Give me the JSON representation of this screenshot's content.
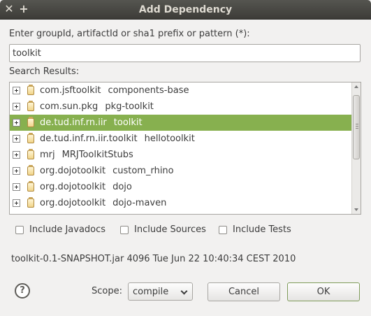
{
  "window": {
    "title": "Add Dependency",
    "close_glyph": "✕",
    "maximize_glyph": "+"
  },
  "search": {
    "label": "Enter groupId, artifactId or sha1 prefix or pattern (*):",
    "value": "toolkit"
  },
  "results": {
    "label": "Search Results:",
    "rows": [
      {
        "group": "com.jsftoolkit",
        "artifact": "components-base",
        "selected": false
      },
      {
        "group": "com.sun.pkg",
        "artifact": "pkg-toolkit",
        "selected": false
      },
      {
        "group": "de.tud.inf.rn.iir",
        "artifact": "toolkit",
        "selected": true
      },
      {
        "group": "de.tud.inf.rn.iir.toolkit",
        "artifact": "hellotoolkit",
        "selected": false
      },
      {
        "group": "mrj",
        "artifact": "MRJToolkitStubs",
        "selected": false
      },
      {
        "group": "org.dojotoolkit",
        "artifact": "custom_rhino",
        "selected": false
      },
      {
        "group": "org.dojotoolkit",
        "artifact": "dojo",
        "selected": false
      },
      {
        "group": "org.dojotoolkit",
        "artifact": "dojo-maven",
        "selected": false
      }
    ]
  },
  "options": {
    "javadocs": "Include Javadocs",
    "sources": "Include Sources",
    "tests": "Include Tests"
  },
  "info_text": "toolkit-0.1-SNAPSHOT.jar 4096 Tue Jun 22 10:40:34 CEST 2010",
  "footer": {
    "help_glyph": "?",
    "scope_label": "Scope:",
    "scope_value": "compile",
    "cancel_label": "Cancel",
    "ok_label": "OK"
  },
  "colors": {
    "selection": "#87b04f",
    "titlebar": "#3d3c38"
  },
  "icons": [
    "close-icon",
    "maximize-icon",
    "expand-icon",
    "jar-icon",
    "help-icon",
    "chevron-down-icon"
  ]
}
